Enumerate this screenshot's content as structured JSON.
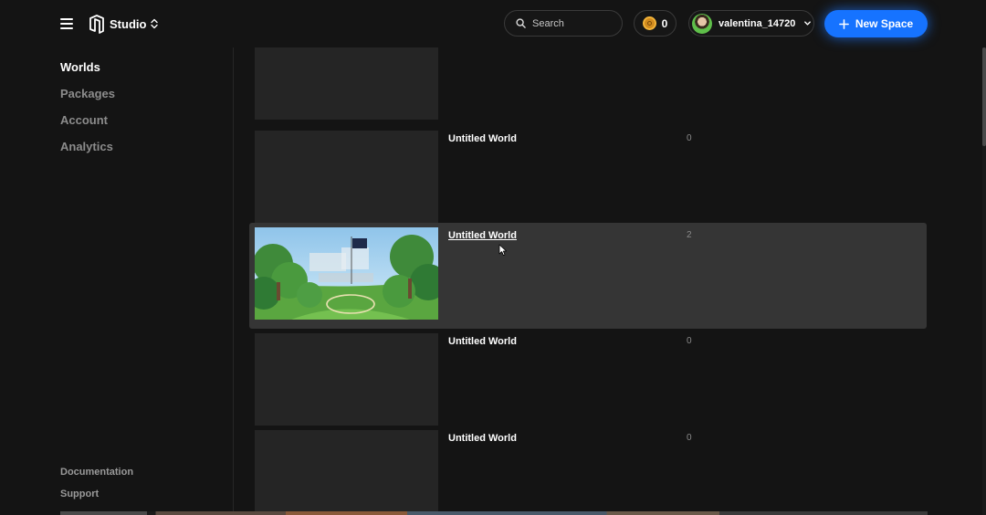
{
  "header": {
    "studio_label": "Studio",
    "search_placeholder": "Search",
    "coin_balance": "0",
    "username": "valentina_14720",
    "new_space_label": "New Space",
    "accent_color": "#1673ff"
  },
  "sidebar": {
    "items": [
      {
        "label": "Worlds",
        "active": true
      },
      {
        "label": "Packages",
        "active": false
      },
      {
        "label": "Account",
        "active": false
      },
      {
        "label": "Analytics",
        "active": false
      }
    ],
    "footer": [
      {
        "label": "Documentation"
      },
      {
        "label": "Support"
      }
    ]
  },
  "worlds": [
    {
      "name": "",
      "count": ""
    },
    {
      "name": "Untitled World",
      "count": "0"
    },
    {
      "name": "Untitled World",
      "count": "2",
      "hovered": true,
      "has_thumbnail": true
    },
    {
      "name": "Untitled World",
      "count": "0"
    },
    {
      "name": "Untitled World",
      "count": "0"
    }
  ]
}
